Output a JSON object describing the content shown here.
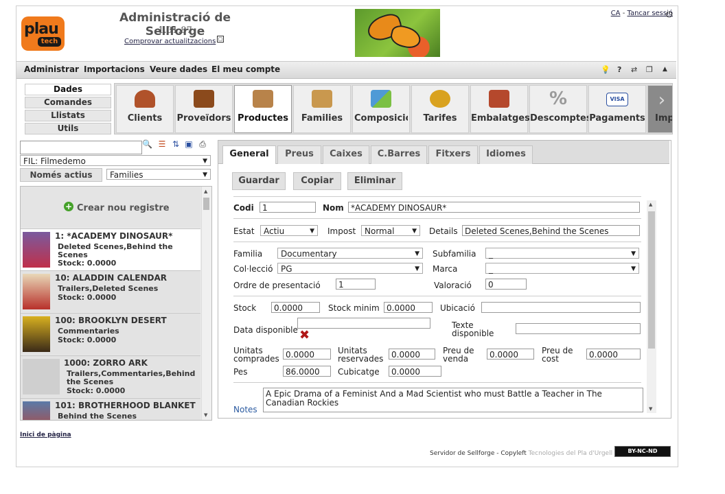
{
  "header": {
    "title": "Administració de Sellforge",
    "version": "1.01.87",
    "check_updates": "Comprovar actualitzacions",
    "logo_top": "plau",
    "logo_bottom": "tech",
    "lang": "CA",
    "separator": "-",
    "logout": "Tancar sessió"
  },
  "menubar": {
    "items": [
      "Administrar",
      "Importacions",
      "Veure dades",
      "El meu compte"
    ],
    "right_icons": [
      "lightbulb-icon",
      "help-icon",
      "swap-icon",
      "window-icon",
      "collapse-icon"
    ]
  },
  "leftmenu": {
    "items": [
      "Dades",
      "Comandes",
      "Llistats",
      "Utils"
    ]
  },
  "modules": [
    {
      "label": "Clients",
      "icon": "clients-icon",
      "color": "#b0522a"
    },
    {
      "label": "Proveïdors",
      "icon": "briefcase-icon",
      "color": "#8b4a1c"
    },
    {
      "label": "Productes",
      "icon": "box-icon",
      "color": "#b8834a",
      "active": true
    },
    {
      "label": "Families",
      "icon": "boxes-icon",
      "color": "#c9984e"
    },
    {
      "label": "Composicions",
      "icon": "blocks-icon",
      "color": "#4f9ad6"
    },
    {
      "label": "Tarifes",
      "icon": "coins-icon",
      "color": "#d9a21f"
    },
    {
      "label": "Embalatges",
      "icon": "package-icon",
      "color": "#b5482c"
    },
    {
      "label": "Descomptes",
      "icon": "percent-icon",
      "color": "#9a9a9a"
    },
    {
      "label": "Pagaments",
      "icon": "visa-icon",
      "color": "#2a4fa0"
    },
    {
      "label": "Imp",
      "icon": "next-icon",
      "color": "#777"
    }
  ],
  "leftpanel": {
    "filter_select": "FIL: Filmedemo",
    "only_active": "Només actius",
    "families_select": "Families",
    "new_record": "Crear nou registre",
    "records": [
      {
        "title": "1: *ACADEMY DINOSAUR*",
        "sub": "Deleted Scenes,Behind the Scenes",
        "stock": "Stock: 0.0000"
      },
      {
        "title": "10: ALADDIN CALENDAR",
        "sub": "Trailers,Deleted Scenes",
        "stock": "Stock: 0.0000"
      },
      {
        "title": "100: BROOKLYN DESERT",
        "sub": "Commentaries",
        "stock": "Stock: 0.0000"
      },
      {
        "title": "1000: ZORRO ARK",
        "sub": "Trailers,Commentaries,Behind the Scenes",
        "stock": "Stock: 0.0000"
      },
      {
        "title": "101: BROTHERHOOD BLANKET",
        "sub": "Behind the Scenes",
        "stock": ""
      }
    ]
  },
  "form": {
    "tabs": [
      "General",
      "Preus",
      "Caixes",
      "C.Barres",
      "Fitxers",
      "Idiomes"
    ],
    "actions": [
      "Guardar",
      "Copiar",
      "Eliminar"
    ],
    "codi_label": "Codi",
    "codi": "1",
    "nom_label": "Nom",
    "nom": "*ACADEMY DINOSAUR*",
    "estat_label": "Estat",
    "estat": "Actiu",
    "impost_label": "Impost",
    "impost": "Normal",
    "details_label": "Details",
    "details": "Deleted Scenes,Behind the Scenes",
    "familia_label": "Familia",
    "familia": "Documentary",
    "subfamilia_label": "Subfamilia",
    "subfamilia": "_",
    "colleccio_label": "Col·lecció",
    "colleccio": "PG",
    "marca_label": "Marca",
    "marca": "_",
    "ordre_label": "Ordre de presentació",
    "ordre": "1",
    "valoracio_label": "Valoració",
    "valoracio": "0",
    "stock_label": "Stock",
    "stock": "0.0000",
    "stockmin_label": "Stock minim",
    "stockmin": "0.0000",
    "ubicacio_label": "Ubicació",
    "ubicacio": "",
    "data_label": "Data disponible",
    "data": "",
    "texte_label_1": "Texte",
    "texte_label_2": "disponible",
    "texte": "",
    "ucomp_label_1": "Unitats",
    "ucomp_label_2": "comprades",
    "ucomp": "0.0000",
    "ureserv_label_1": "Unitats",
    "ureserv_label_2": "reservades",
    "ureserv": "0.0000",
    "pvenda_label_1": "Preu de",
    "pvenda_label_2": "venda",
    "pvenda": "0.0000",
    "pcost_label_1": "Preu de",
    "pcost_label_2": "cost",
    "pcost": "0.0000",
    "pes_label": "Pes",
    "pes": "86.0000",
    "cubicatge_label": "Cubicatge",
    "cubicatge": "0.0000",
    "notes_label": "Notes",
    "notes": "A Epic Drama of a Feminist And a Mad Scientist who must Battle a Teacher in The Canadian Rockies"
  },
  "footer": {
    "top_link": "Inici de pàgina",
    "server_text": "Servidor de Sellforge - Copyleft",
    "company": "Tecnologies del Pla d'Urgell S.L.",
    "cc": "BY-NC-ND"
  },
  "colors": {
    "accent": "#f07a1c",
    "delete": "#b01818",
    "add": "#45a12a"
  }
}
